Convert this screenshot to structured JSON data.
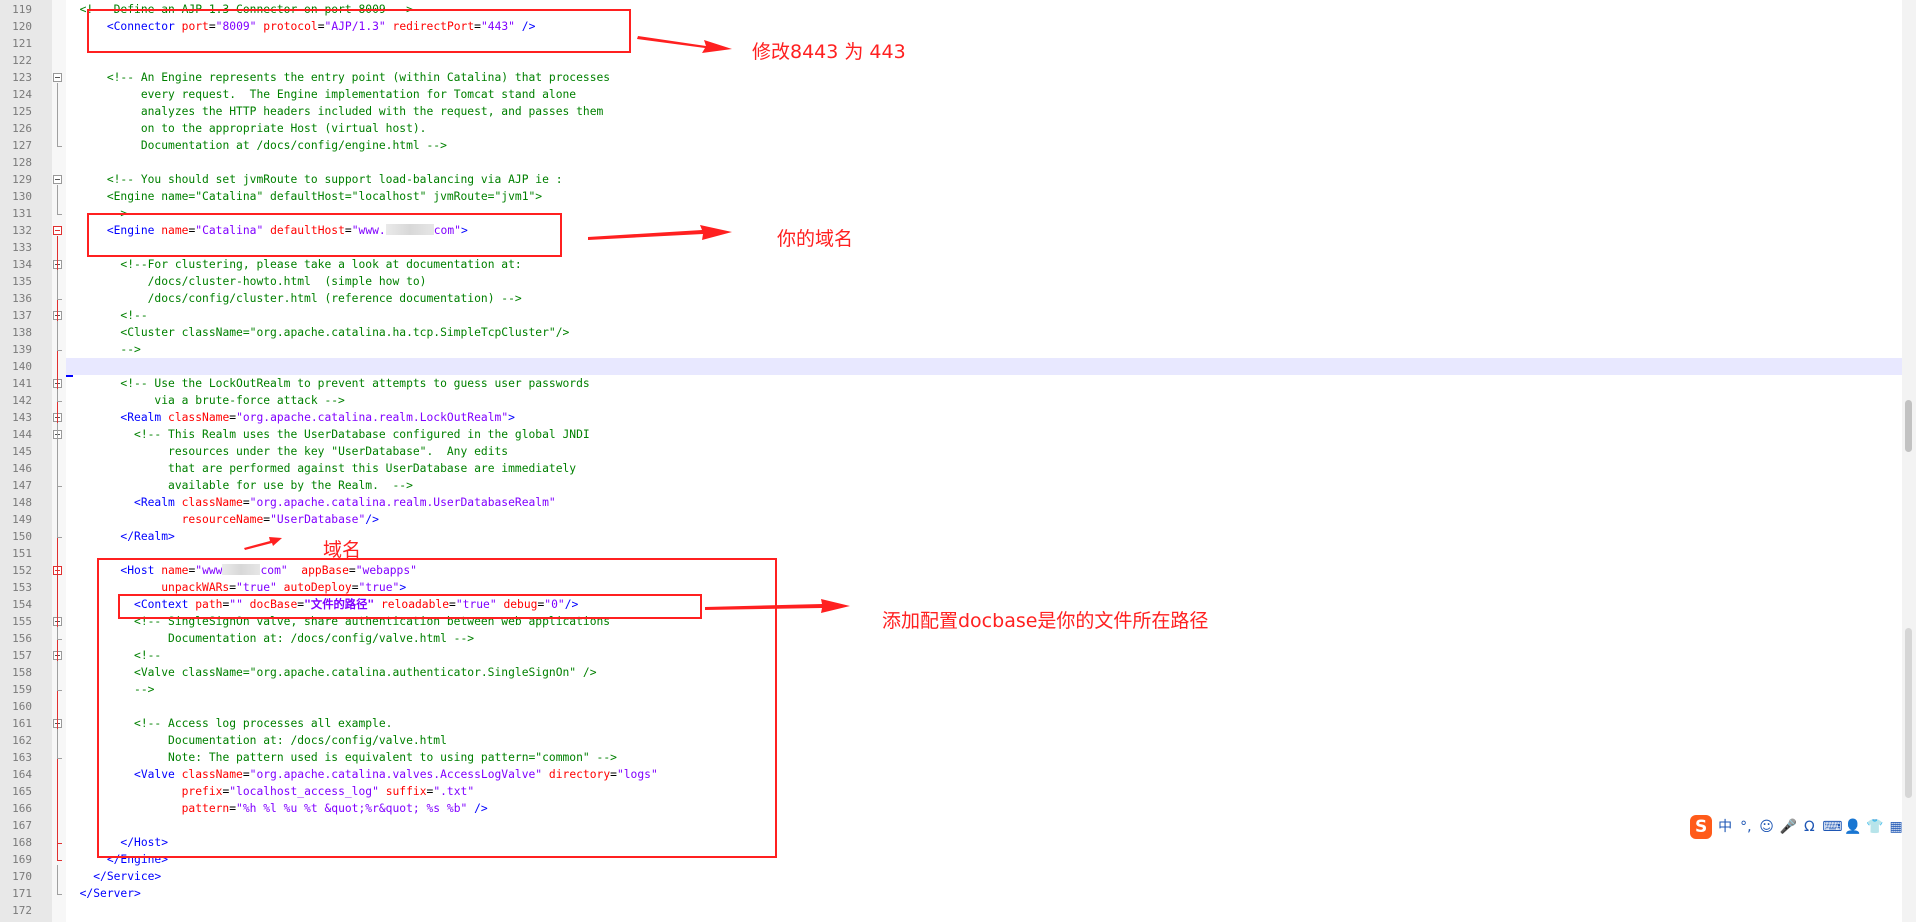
{
  "lines": [
    {
      "num": "119",
      "fold": "none",
      "indent": "",
      "tokens": [
        {
          "c": "c",
          "t": "<!-- Define an AJP 1.3 Connector on port 8009 -->"
        }
      ]
    },
    {
      "num": "120",
      "fold": "none",
      "indent": "    ",
      "tokens": [
        {
          "c": "g",
          "t": "<Connector "
        },
        {
          "c": "a",
          "t": "port"
        },
        {
          "c": "p",
          "t": "="
        },
        {
          "c": "v",
          "t": "\"8009\""
        },
        {
          "c": "a",
          "t": " protocol"
        },
        {
          "c": "p",
          "t": "="
        },
        {
          "c": "v",
          "t": "\"AJP/1.3\""
        },
        {
          "c": "a",
          "t": " redirectPort"
        },
        {
          "c": "p",
          "t": "="
        },
        {
          "c": "v",
          "t": "\"443\""
        },
        {
          "c": "g",
          "t": " />"
        }
      ]
    },
    {
      "num": "121",
      "fold": "none",
      "indent": "",
      "tokens": []
    },
    {
      "num": "122",
      "fold": "none",
      "indent": "",
      "tokens": []
    },
    {
      "num": "123",
      "fold": "open",
      "indent": "    ",
      "tokens": [
        {
          "c": "c",
          "t": "<!-- An Engine represents the entry point (within Catalina) that processes"
        }
      ]
    },
    {
      "num": "124",
      "fold": "none",
      "indent": "         ",
      "tokens": [
        {
          "c": "c",
          "t": "every request.  The Engine implementation for Tomcat stand alone"
        }
      ]
    },
    {
      "num": "125",
      "fold": "none",
      "indent": "         ",
      "tokens": [
        {
          "c": "c",
          "t": "analyzes the HTTP headers included with the request, and passes them"
        }
      ]
    },
    {
      "num": "126",
      "fold": "none",
      "indent": "         ",
      "tokens": [
        {
          "c": "c",
          "t": "on to the appropriate Host (virtual host)."
        }
      ]
    },
    {
      "num": "127",
      "fold": "none",
      "indent": "         ",
      "tokens": [
        {
          "c": "c",
          "t": "Documentation at /docs/config/engine.html -->"
        }
      ]
    },
    {
      "num": "128",
      "fold": "none",
      "indent": "",
      "tokens": []
    },
    {
      "num": "129",
      "fold": "open",
      "indent": "    ",
      "tokens": [
        {
          "c": "c",
          "t": "<!-- You should set jvmRoute to support load-balancing via AJP ie :"
        }
      ]
    },
    {
      "num": "130",
      "fold": "none",
      "indent": "    ",
      "tokens": [
        {
          "c": "c",
          "t": "<Engine name=\"Catalina\" defaultHost=\"localhost\" jvmRoute=\"jvm1\">"
        }
      ]
    },
    {
      "num": "131",
      "fold": "none",
      "indent": "    ",
      "tokens": [
        {
          "c": "c",
          "t": "-->"
        }
      ]
    },
    {
      "num": "132",
      "fold": "open-red",
      "indent": "    ",
      "tokens": [
        {
          "c": "g",
          "t": "<Engine "
        },
        {
          "c": "a",
          "t": "name"
        },
        {
          "c": "p",
          "t": "="
        },
        {
          "c": "v",
          "t": "\"Catalina\""
        },
        {
          "c": "a",
          "t": " defaultHost"
        },
        {
          "c": "p",
          "t": "="
        },
        {
          "c": "v",
          "t": "\"www."
        },
        {
          "c": "blur",
          "t": ""
        },
        {
          "c": "v",
          "t": "com\""
        },
        {
          "c": "g",
          "t": ">"
        }
      ]
    },
    {
      "num": "133",
      "fold": "none",
      "indent": "",
      "tokens": []
    },
    {
      "num": "134",
      "fold": "open",
      "indent": "      ",
      "tokens": [
        {
          "c": "c",
          "t": "<!--For clustering, please take a look at documentation at:"
        }
      ]
    },
    {
      "num": "135",
      "fold": "none",
      "indent": "          ",
      "tokens": [
        {
          "c": "c",
          "t": "/docs/cluster-howto.html  (simple how to)"
        }
      ]
    },
    {
      "num": "136",
      "fold": "none",
      "indent": "          ",
      "tokens": [
        {
          "c": "c",
          "t": "/docs/config/cluster.html (reference documentation) -->"
        }
      ]
    },
    {
      "num": "137",
      "fold": "open",
      "indent": "      ",
      "tokens": [
        {
          "c": "c",
          "t": "<!--"
        }
      ]
    },
    {
      "num": "138",
      "fold": "none",
      "indent": "      ",
      "tokens": [
        {
          "c": "c",
          "t": "<Cluster className=\"org.apache.catalina.ha.tcp.SimpleTcpCluster\"/>"
        }
      ]
    },
    {
      "num": "139",
      "fold": "none",
      "indent": "      ",
      "tokens": [
        {
          "c": "c",
          "t": "-->"
        }
      ]
    },
    {
      "num": "140",
      "fold": "none",
      "indent": "",
      "tokens": []
    },
    {
      "num": "141",
      "fold": "open",
      "indent": "      ",
      "tokens": [
        {
          "c": "c",
          "t": "<!-- Use the LockOutRealm to prevent attempts to guess user passwords"
        }
      ]
    },
    {
      "num": "142",
      "fold": "none",
      "indent": "           ",
      "tokens": [
        {
          "c": "c",
          "t": "via a brute-force attack -->"
        }
      ]
    },
    {
      "num": "143",
      "fold": "open",
      "indent": "      ",
      "tokens": [
        {
          "c": "g",
          "t": "<Realm "
        },
        {
          "c": "a",
          "t": "className"
        },
        {
          "c": "p",
          "t": "="
        },
        {
          "c": "v",
          "t": "\"org.apache.catalina.realm.LockOutRealm\""
        },
        {
          "c": "g",
          "t": ">"
        }
      ]
    },
    {
      "num": "144",
      "fold": "open",
      "indent": "        ",
      "tokens": [
        {
          "c": "c",
          "t": "<!-- This Realm uses the UserDatabase configured in the global JNDI"
        }
      ]
    },
    {
      "num": "145",
      "fold": "none",
      "indent": "             ",
      "tokens": [
        {
          "c": "c",
          "t": "resources under the key \"UserDatabase\".  Any edits"
        }
      ]
    },
    {
      "num": "146",
      "fold": "none",
      "indent": "             ",
      "tokens": [
        {
          "c": "c",
          "t": "that are performed against this UserDatabase are immediately"
        }
      ]
    },
    {
      "num": "147",
      "fold": "none",
      "indent": "             ",
      "tokens": [
        {
          "c": "c",
          "t": "available for use by the Realm.  -->"
        }
      ]
    },
    {
      "num": "148",
      "fold": "none",
      "indent": "        ",
      "tokens": [
        {
          "c": "g",
          "t": "<Realm "
        },
        {
          "c": "a",
          "t": "className"
        },
        {
          "c": "p",
          "t": "="
        },
        {
          "c": "v",
          "t": "\"org.apache.catalina.realm.UserDatabaseRealm\""
        }
      ]
    },
    {
      "num": "149",
      "fold": "none",
      "indent": "               ",
      "tokens": [
        {
          "c": "a",
          "t": "resourceName"
        },
        {
          "c": "p",
          "t": "="
        },
        {
          "c": "v",
          "t": "\"UserDatabase\""
        },
        {
          "c": "g",
          "t": "/>"
        }
      ]
    },
    {
      "num": "150",
      "fold": "none",
      "indent": "      ",
      "tokens": [
        {
          "c": "g",
          "t": "</Realm>"
        }
      ]
    },
    {
      "num": "151",
      "fold": "none",
      "indent": "",
      "tokens": []
    },
    {
      "num": "152",
      "fold": "open-red",
      "indent": "      ",
      "tokens": [
        {
          "c": "g",
          "t": "<Host "
        },
        {
          "c": "a",
          "t": "name"
        },
        {
          "c": "p",
          "t": "="
        },
        {
          "c": "v",
          "t": "\"www"
        },
        {
          "c": "blur-short",
          "t": ""
        },
        {
          "c": "v",
          "t": "com\""
        },
        {
          "c": "a",
          "t": "  appBase"
        },
        {
          "c": "p",
          "t": "="
        },
        {
          "c": "v",
          "t": "\"webapps\""
        }
      ]
    },
    {
      "num": "153",
      "fold": "none",
      "indent": "            ",
      "tokens": [
        {
          "c": "a",
          "t": "unpackWARs"
        },
        {
          "c": "p",
          "t": "="
        },
        {
          "c": "v",
          "t": "\"true\""
        },
        {
          "c": "a",
          "t": " autoDeploy"
        },
        {
          "c": "p",
          "t": "="
        },
        {
          "c": "v",
          "t": "\"true\""
        },
        {
          "c": "g",
          "t": ">"
        }
      ]
    },
    {
      "num": "154",
      "fold": "none",
      "indent": "        ",
      "tokens": [
        {
          "c": "g",
          "t": "<Context "
        },
        {
          "c": "a",
          "t": "path"
        },
        {
          "c": "p",
          "t": "="
        },
        {
          "c": "v",
          "t": "\"\""
        },
        {
          "c": "a",
          "t": " docBase"
        },
        {
          "c": "p",
          "t": "="
        },
        {
          "c": "b",
          "t": "\"文件的路径\""
        },
        {
          "c": "a",
          "t": " reloadable"
        },
        {
          "c": "p",
          "t": "="
        },
        {
          "c": "v",
          "t": "\"true\""
        },
        {
          "c": "a",
          "t": " debug"
        },
        {
          "c": "p",
          "t": "="
        },
        {
          "c": "v",
          "t": "\"0\""
        },
        {
          "c": "g",
          "t": "/>"
        }
      ]
    },
    {
      "num": "155",
      "fold": "open",
      "indent": "        ",
      "tokens": [
        {
          "c": "c",
          "t": "<!-- SingleSignOn valve, share authentication between web applications"
        }
      ]
    },
    {
      "num": "156",
      "fold": "none",
      "indent": "             ",
      "tokens": [
        {
          "c": "c",
          "t": "Documentation at: /docs/config/valve.html -->"
        }
      ]
    },
    {
      "num": "157",
      "fold": "open",
      "indent": "        ",
      "tokens": [
        {
          "c": "c",
          "t": "<!--"
        }
      ]
    },
    {
      "num": "158",
      "fold": "none",
      "indent": "        ",
      "tokens": [
        {
          "c": "c",
          "t": "<Valve className=\"org.apache.catalina.authenticator.SingleSignOn\" />"
        }
      ]
    },
    {
      "num": "159",
      "fold": "none",
      "indent": "        ",
      "tokens": [
        {
          "c": "c",
          "t": "-->"
        }
      ]
    },
    {
      "num": "160",
      "fold": "none",
      "indent": "",
      "tokens": []
    },
    {
      "num": "161",
      "fold": "open",
      "indent": "        ",
      "tokens": [
        {
          "c": "c",
          "t": "<!-- Access log processes all example."
        }
      ]
    },
    {
      "num": "162",
      "fold": "none",
      "indent": "             ",
      "tokens": [
        {
          "c": "c",
          "t": "Documentation at: /docs/config/valve.html"
        }
      ]
    },
    {
      "num": "163",
      "fold": "none",
      "indent": "             ",
      "tokens": [
        {
          "c": "c",
          "t": "Note: The pattern used is equivalent to using pattern=\"common\" -->"
        }
      ]
    },
    {
      "num": "164",
      "fold": "none",
      "indent": "        ",
      "tokens": [
        {
          "c": "g",
          "t": "<Valve "
        },
        {
          "c": "a",
          "t": "className"
        },
        {
          "c": "p",
          "t": "="
        },
        {
          "c": "v",
          "t": "\"org.apache.catalina.valves.AccessLogValve\""
        },
        {
          "c": "a",
          "t": " directory"
        },
        {
          "c": "p",
          "t": "="
        },
        {
          "c": "v",
          "t": "\"logs\""
        }
      ]
    },
    {
      "num": "165",
      "fold": "none",
      "indent": "               ",
      "tokens": [
        {
          "c": "a",
          "t": "prefix"
        },
        {
          "c": "p",
          "t": "="
        },
        {
          "c": "v",
          "t": "\"localhost_access_log\""
        },
        {
          "c": "a",
          "t": " suffix"
        },
        {
          "c": "p",
          "t": "="
        },
        {
          "c": "v",
          "t": "\".txt\""
        }
      ]
    },
    {
      "num": "166",
      "fold": "none",
      "indent": "               ",
      "tokens": [
        {
          "c": "a",
          "t": "pattern"
        },
        {
          "c": "p",
          "t": "="
        },
        {
          "c": "v",
          "t": "\"%h %l %u %t &quot;%r&quot; %s %b\""
        },
        {
          "c": "g",
          "t": " />"
        }
      ]
    },
    {
      "num": "167",
      "fold": "none",
      "indent": "",
      "tokens": []
    },
    {
      "num": "168",
      "fold": "none",
      "indent": "      ",
      "tokens": [
        {
          "c": "g",
          "t": "</Host>"
        }
      ]
    },
    {
      "num": "169",
      "fold": "none",
      "indent": "    ",
      "tokens": [
        {
          "c": "g",
          "t": "</Engine>"
        }
      ]
    },
    {
      "num": "170",
      "fold": "none",
      "indent": "  ",
      "tokens": [
        {
          "c": "g",
          "t": "</Service>"
        }
      ]
    },
    {
      "num": "171",
      "fold": "none",
      "indent": "",
      "tokens": [
        {
          "c": "g",
          "t": "</Server>"
        }
      ]
    },
    {
      "num": "172",
      "fold": "none",
      "indent": "",
      "tokens": []
    }
  ],
  "current_line": "140",
  "annotations": {
    "connector_note": "修改8443  为  443",
    "engine_note": "你的域名",
    "host_note": "域名",
    "context_note": "添加配置docbase是你的文件所在路径"
  },
  "ime_toolbar": {
    "logo": "S",
    "buttons": [
      {
        "name": "chinese-mode",
        "glyph": "中"
      },
      {
        "name": "punctuation",
        "glyph": "°,"
      },
      {
        "name": "emoji",
        "glyph": "☺"
      },
      {
        "name": "voice",
        "glyph": "🎤"
      },
      {
        "name": "headset",
        "glyph": "Ω"
      },
      {
        "name": "keyboard",
        "glyph": "⌨"
      },
      {
        "name": "user",
        "glyph": "👤"
      },
      {
        "name": "skin",
        "glyph": "👕"
      },
      {
        "name": "toolbox",
        "glyph": "▦"
      }
    ]
  },
  "colors": {
    "tag": "#0000ff",
    "attribute": "#ff0000",
    "value": "#8000ff",
    "comment": "#008000",
    "annotation": "#ff2020"
  }
}
